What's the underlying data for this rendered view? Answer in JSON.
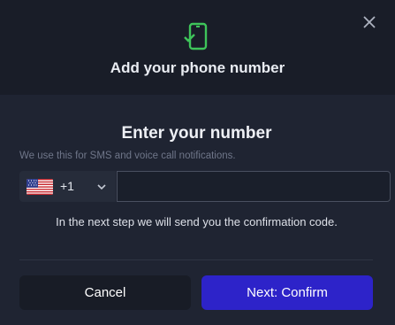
{
  "header": {
    "title": "Add your phone number",
    "icon": "phone-check-icon",
    "accent_color": "#3ec45a"
  },
  "form": {
    "title": "Enter your number",
    "subtitle": "We use this for SMS and voice call notifications.",
    "country": {
      "flag": "us-flag-icon",
      "dial_code": "+1"
    },
    "phone_value": "",
    "hint": "In the next step we will send you the confirmation code."
  },
  "actions": {
    "cancel_label": "Cancel",
    "confirm_label": "Next: Confirm",
    "confirm_color": "#2d23c9"
  }
}
